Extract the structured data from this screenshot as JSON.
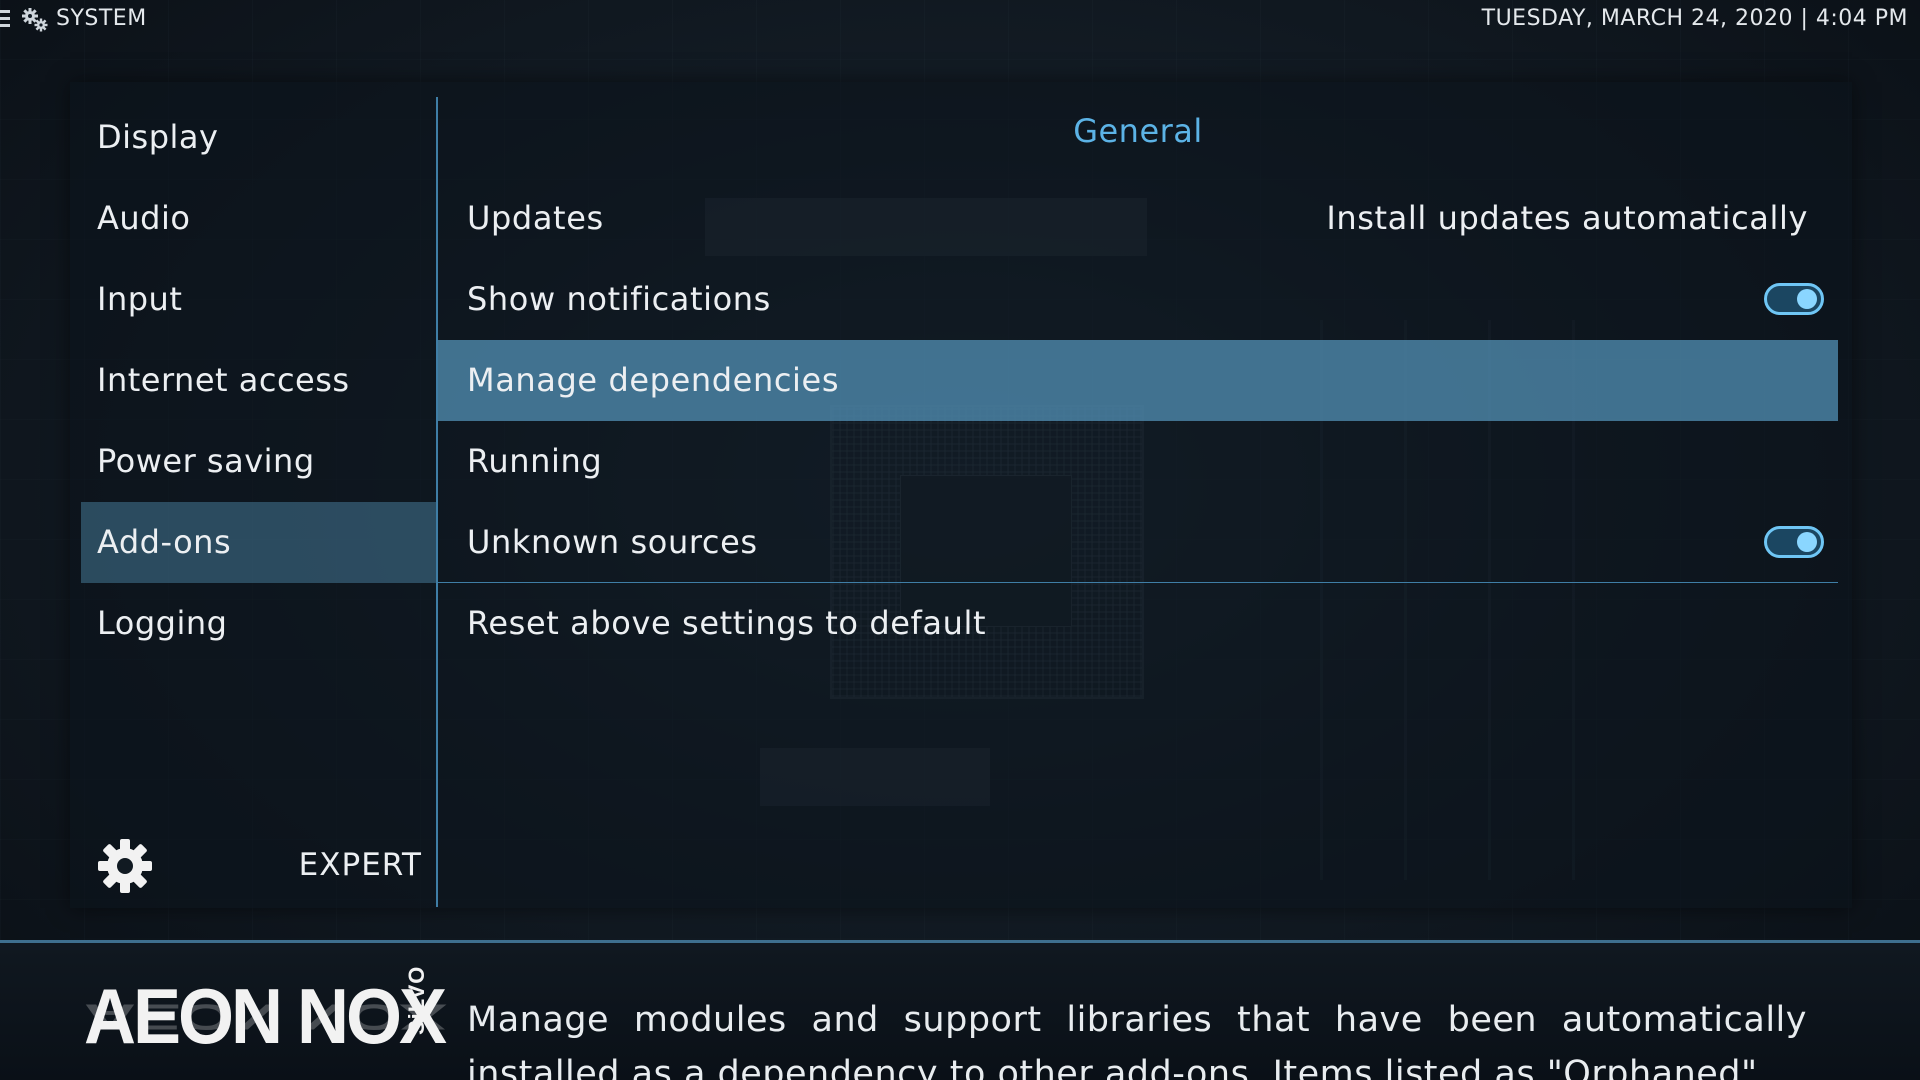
{
  "topbar": {
    "title": "SYSTEM",
    "datetime": "TUESDAY, MARCH 24, 2020 | 4:04 PM"
  },
  "sidebar": {
    "items": [
      {
        "label": "Display",
        "selected": false
      },
      {
        "label": "Audio",
        "selected": false
      },
      {
        "label": "Input",
        "selected": false
      },
      {
        "label": "Internet access",
        "selected": false
      },
      {
        "label": "Power saving",
        "selected": false
      },
      {
        "label": "Add-ons",
        "selected": true
      },
      {
        "label": "Logging",
        "selected": false
      }
    ],
    "level_label": "EXPERT"
  },
  "section": {
    "title": "General"
  },
  "settings": [
    {
      "label": "Updates",
      "value": "Install updates automatically",
      "selected": false
    },
    {
      "label": "Show notifications",
      "toggle": true,
      "selected": false
    },
    {
      "label": "Manage dependencies",
      "selected": true
    },
    {
      "label": "Running",
      "selected": false
    },
    {
      "label": "Unknown sources",
      "toggle": true,
      "selected": false
    },
    {
      "label": "Reset above settings to default",
      "selected": false
    }
  ],
  "info": {
    "logo_main": "AEON NOX",
    "logo_sub": "SiLVO",
    "description": "Manage modules and support libraries that have been automatically installed as a dependency to other add-ons. Items listed as \"Orphaned\""
  },
  "colors": {
    "accent": "#5cb3e6",
    "selection": "#508caf",
    "divider": "#3f7ea6"
  }
}
